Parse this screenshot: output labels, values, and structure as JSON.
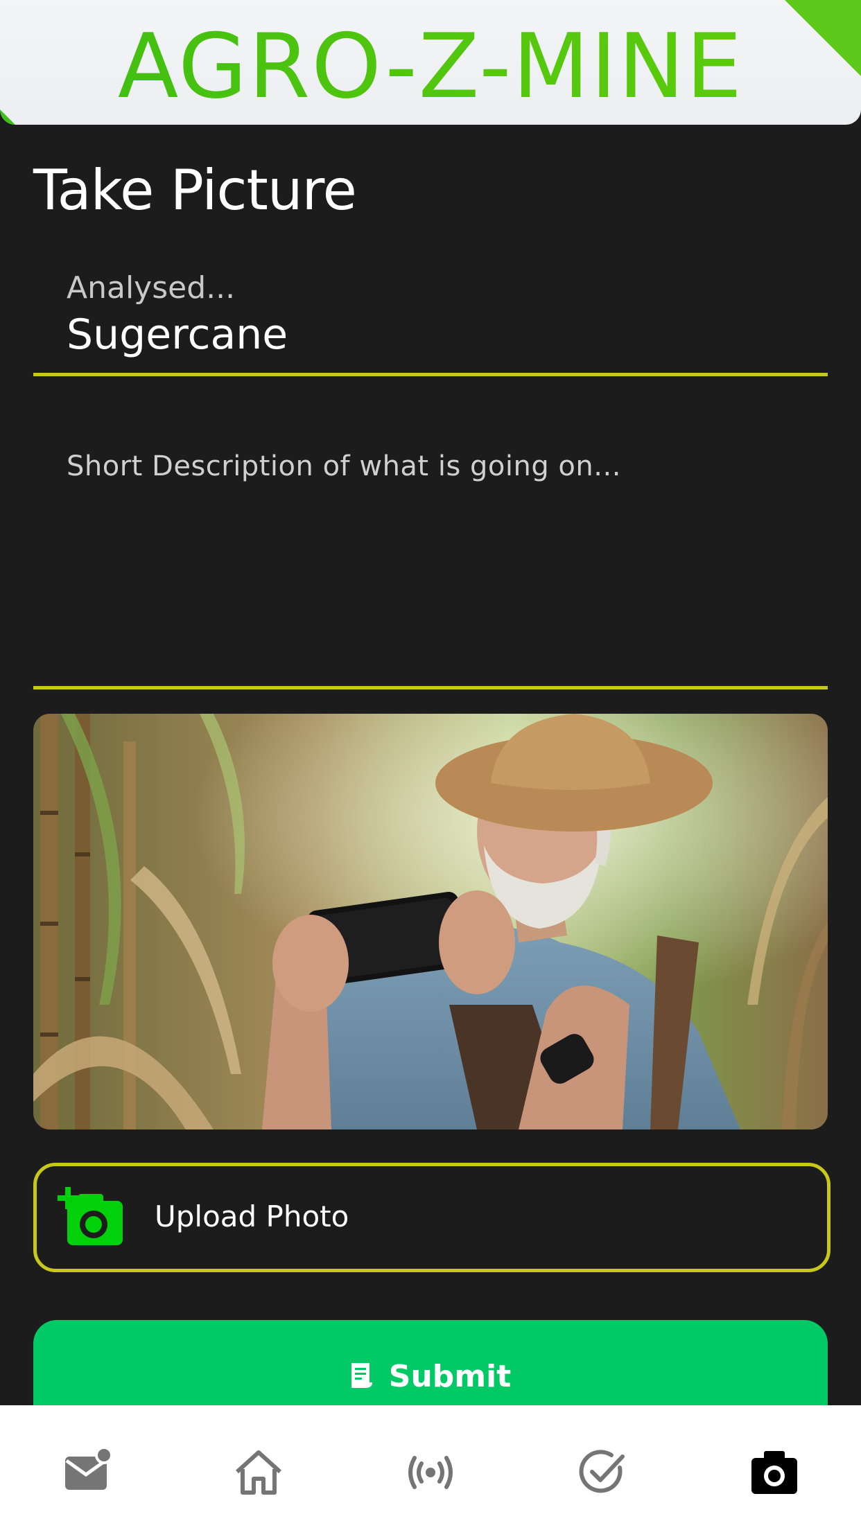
{
  "header": {
    "brand": "AGRO-Z-MINE"
  },
  "page": {
    "title": "Take Picture"
  },
  "form": {
    "crop_label": "Analysed...",
    "crop_value": "Sugercane",
    "description_placeholder": "Short Description of what is going on...",
    "description_value": ""
  },
  "actions": {
    "upload_label": "Upload Photo",
    "submit_label": "Submit"
  },
  "bottom_nav": {
    "items": [
      {
        "icon": "mail-notification-icon",
        "active": false
      },
      {
        "icon": "home-icon",
        "active": false
      },
      {
        "icon": "broadcast-icon",
        "active": false
      },
      {
        "icon": "check-circle-icon",
        "active": false
      },
      {
        "icon": "camera-icon",
        "active": true
      }
    ]
  },
  "colors": {
    "background": "#1c1c1c",
    "brand_green": "#4cc414",
    "field_underline": "#c8c81a",
    "submit_green": "#00c966",
    "upload_icon_green": "#00d10a"
  }
}
